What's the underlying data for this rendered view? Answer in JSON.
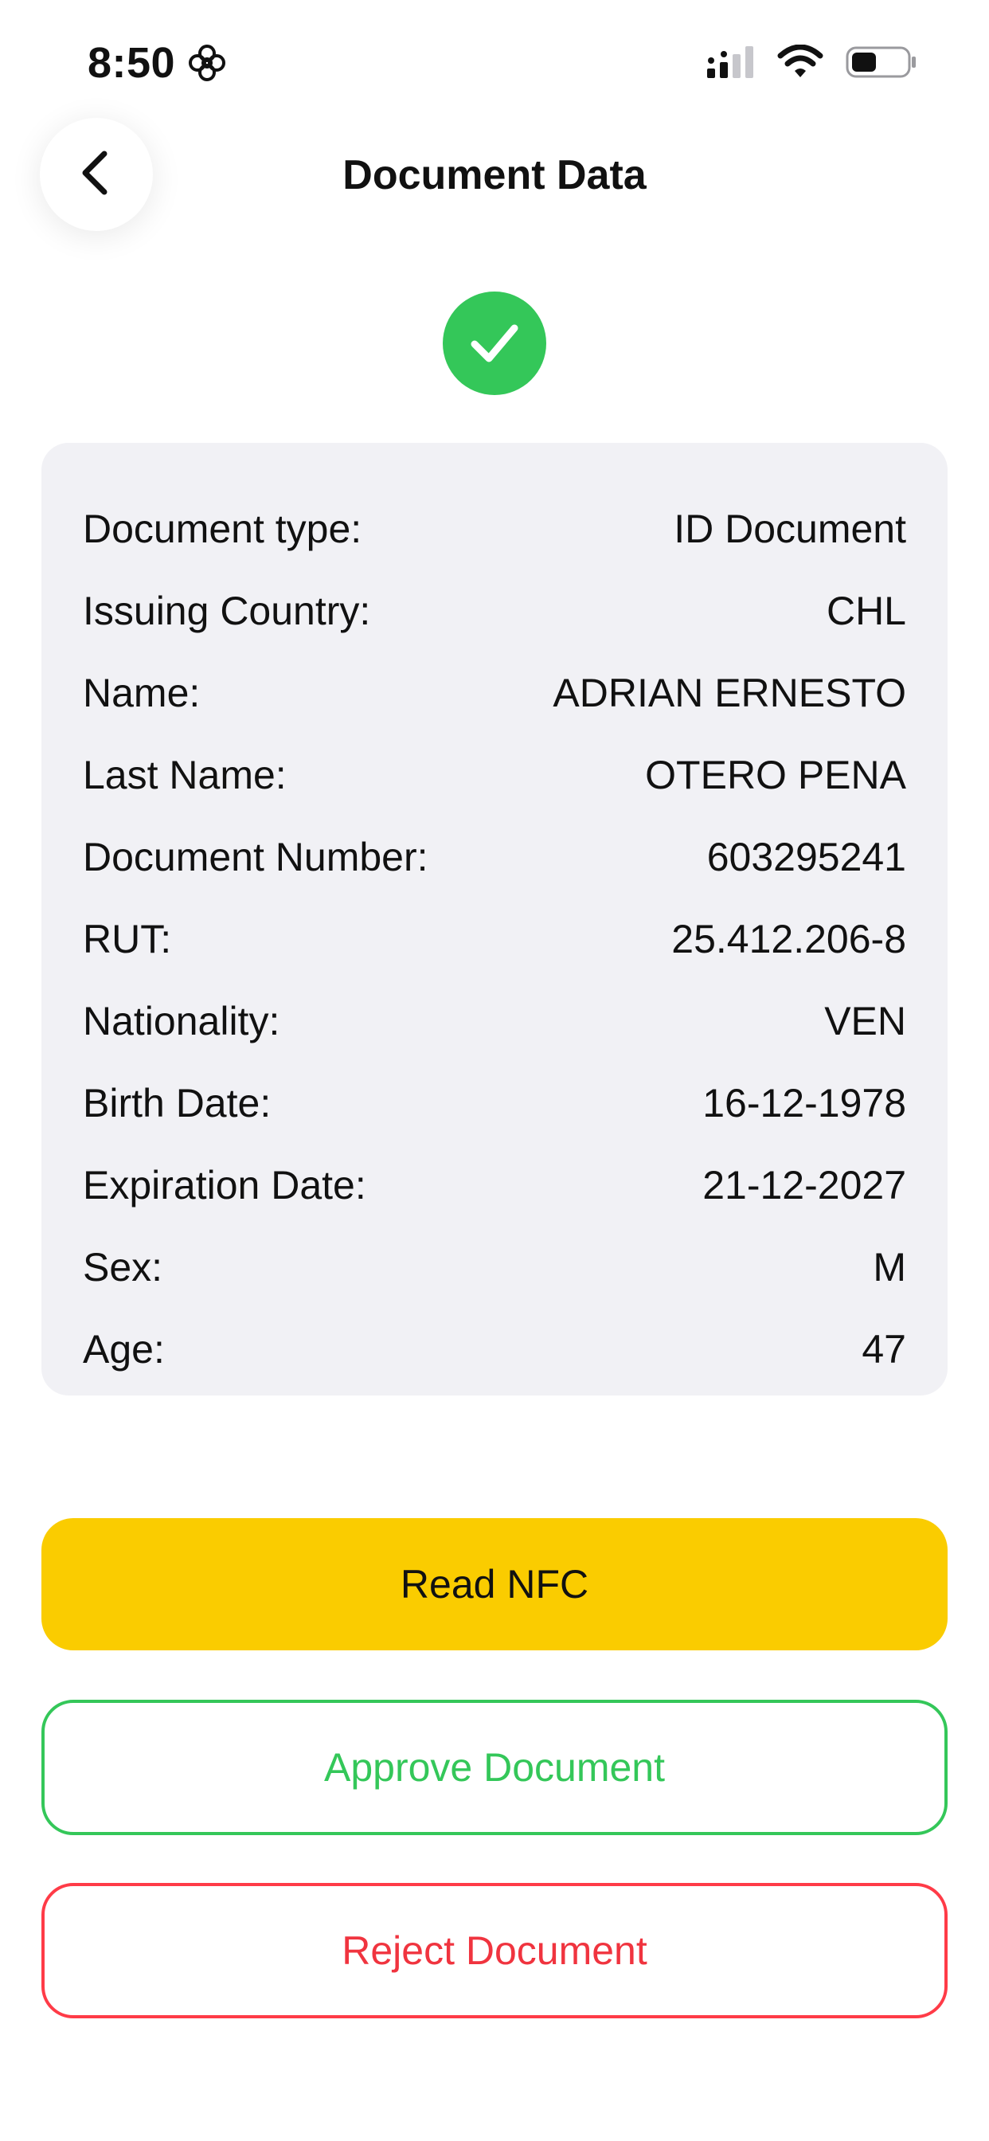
{
  "status_bar": {
    "time": "8:50",
    "focus_icon": "flower-focus-icon",
    "signal_icon": "cellular-signal-icon",
    "wifi_icon": "wifi-icon",
    "battery_icon": "battery-icon"
  },
  "header": {
    "title": "Document Data",
    "back_icon": "chevron-left-icon"
  },
  "status": {
    "icon": "check-circle-icon",
    "color": "#34c759"
  },
  "document": {
    "rows": [
      {
        "label": "Document type:",
        "value": "ID Document"
      },
      {
        "label": "Issuing Country:",
        "value": "CHL"
      },
      {
        "label": "Name:",
        "value": "ADRIAN ERNESTO"
      },
      {
        "label": "Last Name:",
        "value": "OTERO PENA"
      },
      {
        "label": "Document Number:",
        "value": "603295241"
      },
      {
        "label": "RUT:",
        "value": "25.412.206-8"
      },
      {
        "label": "Nationality:",
        "value": "VEN"
      },
      {
        "label": "Birth Date:",
        "value": "16-12-1978"
      },
      {
        "label": "Expiration Date:",
        "value": "21-12-2027"
      },
      {
        "label": "Sex:",
        "value": "M"
      },
      {
        "label": "Age:",
        "value": "47"
      }
    ]
  },
  "actions": {
    "read_nfc": "Read NFC",
    "approve": "Approve Document",
    "reject": "Reject Document"
  },
  "colors": {
    "nfc": "#facc00",
    "approve": "#34c759",
    "reject": "#ff3b47",
    "card": "#f1f1f5"
  }
}
